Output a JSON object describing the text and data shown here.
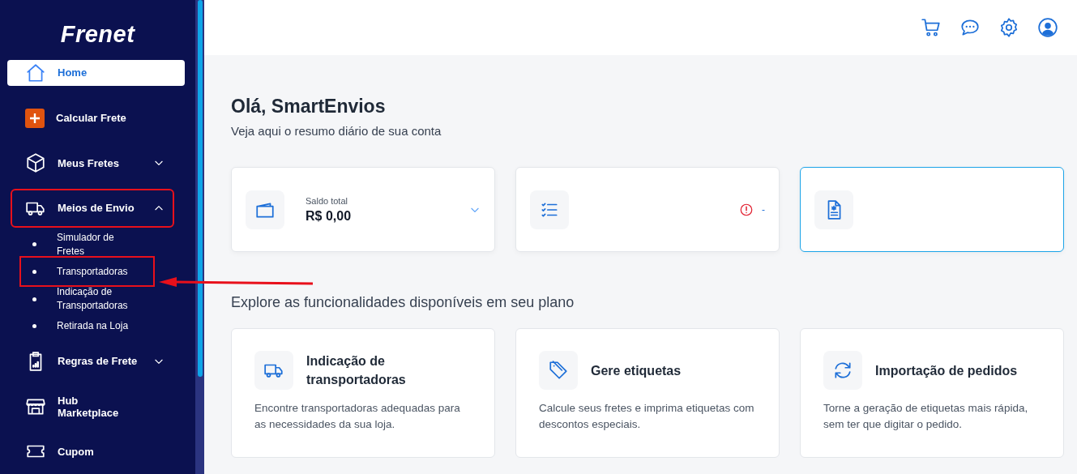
{
  "sidebar": {
    "logo": "Frenet",
    "items": [
      {
        "label": "Home",
        "selected": true
      },
      {
        "label": "Calcular Frete",
        "selected": false
      },
      {
        "label": "Meus Fretes",
        "selected": false,
        "expanded": false
      },
      {
        "label": "Meios de Envio",
        "selected": false,
        "expanded": true,
        "highlighted": true,
        "children": [
          {
            "label": "Simulador de Fretes",
            "highlighted": false
          },
          {
            "label": "Transportadoras",
            "highlighted": true
          },
          {
            "label": "Indicação de Transportadoras",
            "highlighted": false
          },
          {
            "label": "Retirada na Loja",
            "highlighted": false
          }
        ]
      },
      {
        "label": "Regras de Frete",
        "selected": false,
        "expanded": false
      },
      {
        "label": "Hub Marketplace",
        "selected": false
      },
      {
        "label": "Cupom",
        "selected": false
      }
    ]
  },
  "greeting": {
    "title": "Olá, SmartEnvios",
    "subtitle": "Veja aqui o resumo diário de sua conta"
  },
  "summary_cards": [
    {
      "label": "Saldo total",
      "value": "R$ 0,00",
      "highlighted": false
    },
    {
      "status": "-",
      "highlighted": false
    },
    {
      "highlighted": true
    }
  ],
  "explore": {
    "title": "Explore as funcionalidades disponíveis em seu plano",
    "cards": [
      {
        "title": "Indicação de transportadoras",
        "description": "Encontre transportadoras adequadas para as necessidades da sua loja."
      },
      {
        "title": "Gere etiquetas",
        "description": "Calcule seus fretes e imprima etiquetas com descontos especiais."
      },
      {
        "title": "Importação de pedidos",
        "description": "Torne a geração de etiquetas mais rápida, sem ter que digitar o pedido."
      }
    ]
  }
}
